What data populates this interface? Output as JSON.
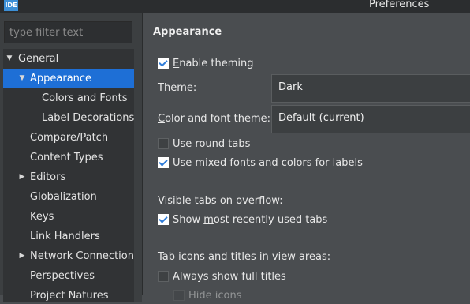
{
  "window": {
    "icon_text": "IDE",
    "title": "Preferences"
  },
  "filter": {
    "placeholder": "type filter text"
  },
  "tree": [
    {
      "label": "General",
      "expanded": true
    },
    {
      "label": "Appearance",
      "expanded": true,
      "selected": true
    },
    {
      "label": "Colors and Fonts"
    },
    {
      "label": "Label Decorations"
    },
    {
      "label": "Compare/Patch"
    },
    {
      "label": "Content Types"
    },
    {
      "label": "Editors",
      "expanded": false
    },
    {
      "label": "Globalization"
    },
    {
      "label": "Keys"
    },
    {
      "label": "Link Handlers"
    },
    {
      "label": "Network Connections",
      "expanded": false
    },
    {
      "label": "Perspectives"
    },
    {
      "label": "Project Natures"
    }
  ],
  "page": {
    "title": "Appearance",
    "enable_theming": {
      "mnemonic": "E",
      "rest": "nable theming",
      "checked": true
    },
    "theme": {
      "mnemonic": "T",
      "rest": "heme:",
      "value": "Dark"
    },
    "color_font_theme": {
      "mnemonic": "C",
      "rest": "olor and font theme:",
      "value": "Default (current)"
    },
    "round_tabs": {
      "mnemonic": "U",
      "rest": "se round tabs",
      "checked": false
    },
    "mixed_fonts": {
      "mnemonic": "U",
      "rest": "se mixed fonts and colors for labels",
      "checked": true
    },
    "visible_tabs_label": "Visible tabs on overflow:",
    "mru_tabs": {
      "pre": "Show ",
      "mnemonic": "m",
      "rest": "ost recently used tabs",
      "checked": true
    },
    "tab_icons_label": "Tab icons and titles in view areas:",
    "full_titles": {
      "label": "Always show full titles",
      "checked": false
    },
    "hide_icons": {
      "label": "Hide icons",
      "checked": false
    }
  }
}
